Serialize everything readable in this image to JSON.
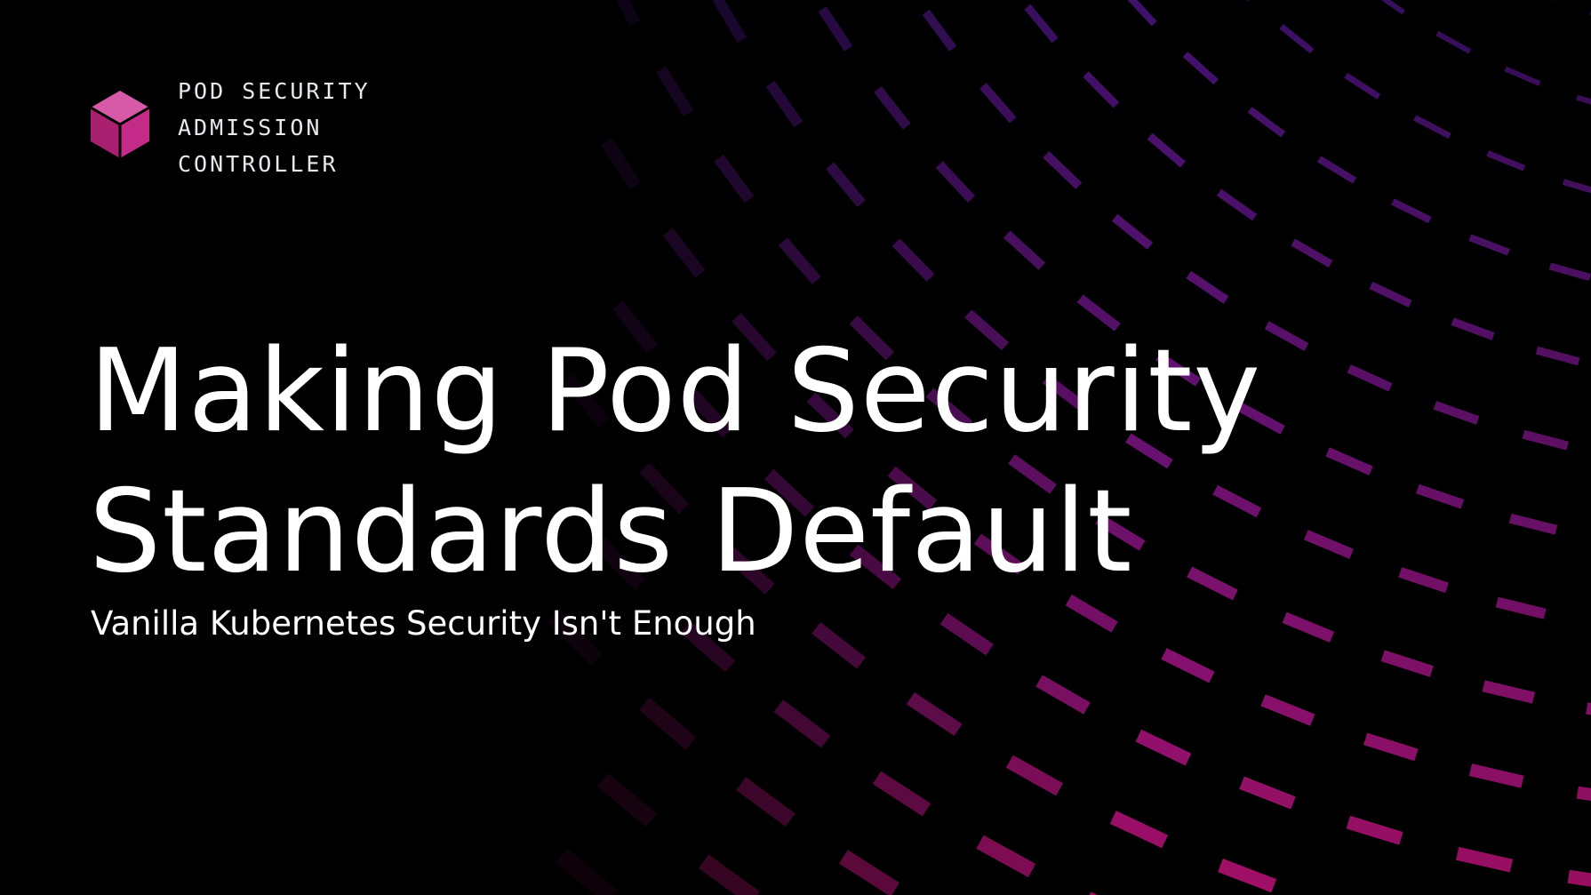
{
  "brand": {
    "lines": [
      "POD SECURITY",
      "ADMISSION",
      "CONTROLLER"
    ],
    "logo_icon": "cube-icon"
  },
  "title": {
    "line1": "Making Pod Security",
    "line2": "Standards Default"
  },
  "subtitle": "Vanilla Kubernetes Security Isn't Enough",
  "colors": {
    "background": "#000000",
    "accent_top": "#7a22d6",
    "accent_bottom": "#c4127a",
    "logo": "#c02a8c",
    "text": "#ffffff"
  }
}
